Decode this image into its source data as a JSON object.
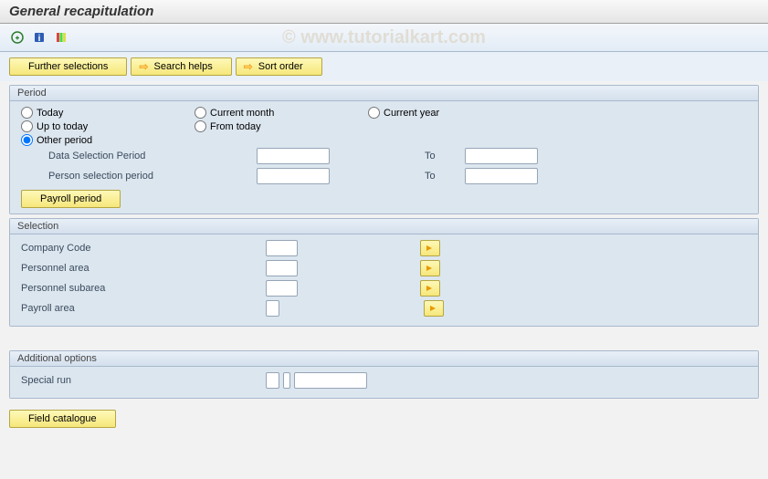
{
  "watermark": "© www.tutorialkart.com",
  "title": "General recapitulation",
  "toolbar_buttons": {
    "further_selections": "Further selections",
    "search_helps": "Search helps",
    "sort_order": "Sort order"
  },
  "period": {
    "title": "Period",
    "radios": {
      "today": "Today",
      "current_month": "Current month",
      "current_year": "Current year",
      "up_to_today": "Up to today",
      "from_today": "From today",
      "other_period": "Other period"
    },
    "selected": "other_period",
    "fields": {
      "data_selection": "Data Selection Period",
      "person_selection": "Person selection period",
      "to": "To"
    },
    "values": {
      "data_from": "",
      "data_to": "",
      "person_from": "",
      "person_to": ""
    },
    "payroll_button": "Payroll period"
  },
  "selection": {
    "title": "Selection",
    "fields": {
      "company_code": "Company Code",
      "personnel_area": "Personnel area",
      "personnel_subarea": "Personnel subarea",
      "payroll_area": "Payroll area"
    },
    "values": {
      "company_code": "",
      "personnel_area": "",
      "personnel_subarea": "",
      "payroll_area": ""
    }
  },
  "additional": {
    "title": "Additional options",
    "special_run": "Special run",
    "values": {
      "sr1": "",
      "sr2": "",
      "sr3": ""
    }
  },
  "bottom": {
    "field_catalogue": "Field catalogue"
  }
}
